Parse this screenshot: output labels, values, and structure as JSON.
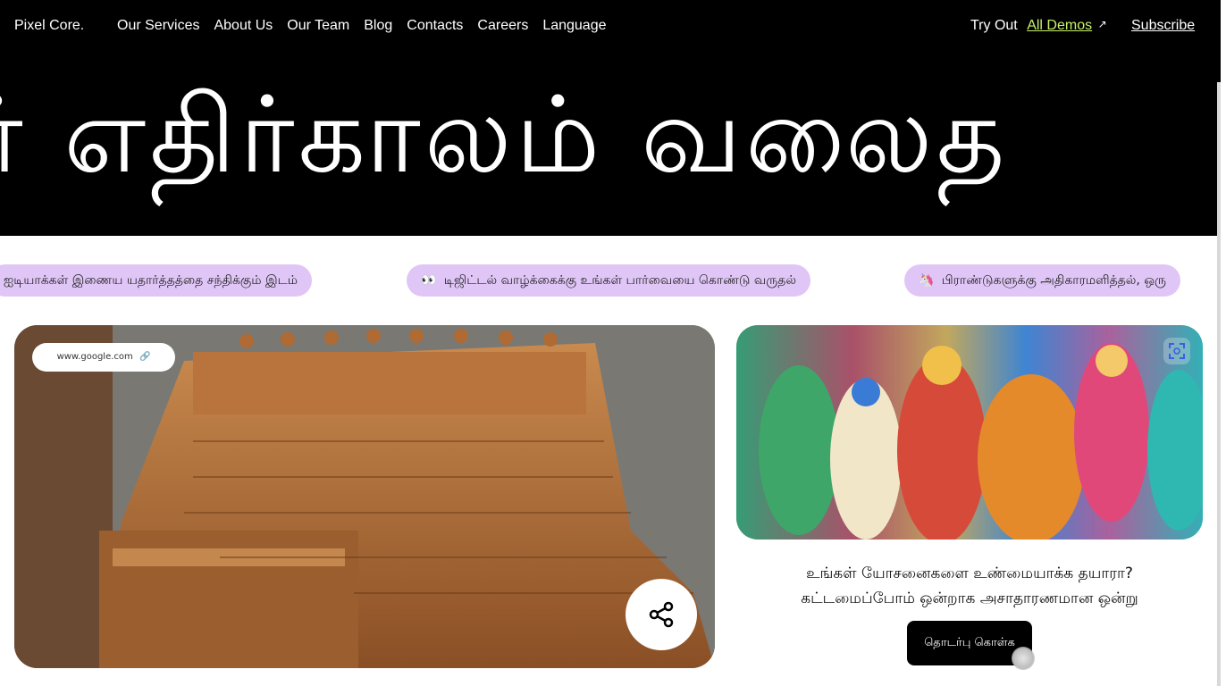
{
  "nav": {
    "brand": "Pixel Core.",
    "links": [
      "Our Services",
      "About Us",
      "Our Team",
      "Blog",
      "Contacts",
      "Careers",
      "Language"
    ],
    "try_label": "Try Out",
    "demos_label": "All Demos",
    "demos_icon": "external-arrow-icon",
    "subscribe_label": "Subscribe"
  },
  "hero": {
    "big_text": "ர் எதிர்காலம் வலைத"
  },
  "marquee": {
    "items": [
      {
        "emoji": "",
        "text": "ஐடியாக்கள் இணைய யதார்த்தத்தை சந்திக்கும் இடம்"
      },
      {
        "emoji": "👀",
        "text": "டிஜிட்டல் வாழ்க்கைக்கு உங்கள் பார்வையை கொண்டு வருதல்"
      },
      {
        "emoji": "🦄",
        "text": "பிராண்டுகளுக்கு அதிகாரமளித்தல், ஒரு"
      }
    ]
  },
  "card_left": {
    "url": "www.google.com",
    "url_icon": "link-icon",
    "share_icon": "share-icon"
  },
  "card_right": {
    "expand_icon": "fullscreen-icon",
    "line1": "உங்கள் யோசனைகளை உண்மையாக்க தயாரா?",
    "line2": "கட்டமைப்போம் ஒன்றாக அசாதாரணமான ஒன்று",
    "cta_label": "தொடர்பு கொள்க"
  },
  "colors": {
    "accent": "#c7f26b",
    "pill": "#e0c6f7",
    "hero_bg": "#000000"
  }
}
